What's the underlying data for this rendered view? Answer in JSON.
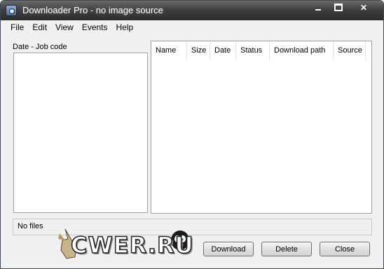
{
  "window": {
    "title": "Downloader Pro - no image source"
  },
  "menu": [
    "File",
    "Edit",
    "View",
    "Events",
    "Help"
  ],
  "left_panel": {
    "label": "Date - Job code",
    "items": []
  },
  "file_list": {
    "columns": [
      "Name",
      "Size",
      "Date",
      "Status",
      "Download path",
      "Source"
    ],
    "rows": []
  },
  "status": {
    "text": "No files"
  },
  "watermark": {
    "text": "CWER.RU"
  },
  "buttons": {
    "download": "Download",
    "delete": "Delete",
    "close": "Close"
  },
  "icons": {
    "app": "downloader-app-icon",
    "minimize": "minimize-icon",
    "maximize": "maximize-icon",
    "close": "close-icon"
  }
}
